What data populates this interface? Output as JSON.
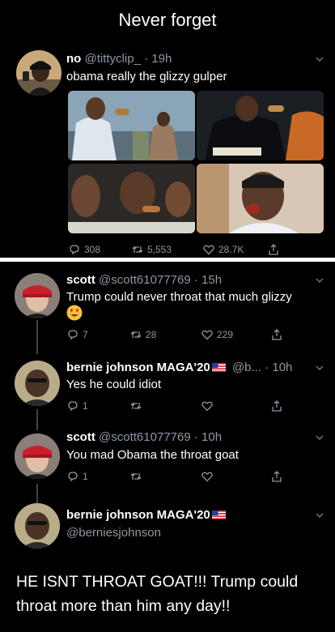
{
  "caption": "Never forget",
  "top_tweet": {
    "name": "no",
    "handle": "@tittyclip_",
    "time": "· 19h",
    "text": "obama really the glizzy gulper",
    "replies": "308",
    "retweets": "5,553",
    "likes": "28.7K"
  },
  "thread": [
    {
      "name": "scott",
      "handle": "@scott61077769",
      "time": "· 15h",
      "text": "Trump could never throat that much glizzy",
      "replies": "7",
      "retweets": "28",
      "likes": "229"
    },
    {
      "name": "bernie johnson MAGA'20",
      "handle": "@b...",
      "time": "· 10h",
      "text": "Yes he could idiot",
      "replies": "1",
      "retweets": "",
      "likes": ""
    },
    {
      "name": "scott",
      "handle": "@scott61077769",
      "time": "· 10h",
      "text": "You mad Obama the throat goat",
      "replies": "1",
      "retweets": "",
      "likes": ""
    }
  ],
  "focused_tweet": {
    "name": "bernie johnson MAGA'20",
    "handle": "@berniesjohnson",
    "text": "HE ISNT THROAT GOAT!!! Trump could throat more than him any day!!"
  },
  "colors": {
    "background": "#000000",
    "muted": "#8b98a5",
    "thread_line": "#3d4650",
    "divider": "#ffffff"
  },
  "icons": [
    "reply-icon",
    "retweet-icon",
    "like-icon",
    "share-icon",
    "chevron-down-icon",
    "us-flag-icon",
    "heart-eyes-emoji"
  ]
}
